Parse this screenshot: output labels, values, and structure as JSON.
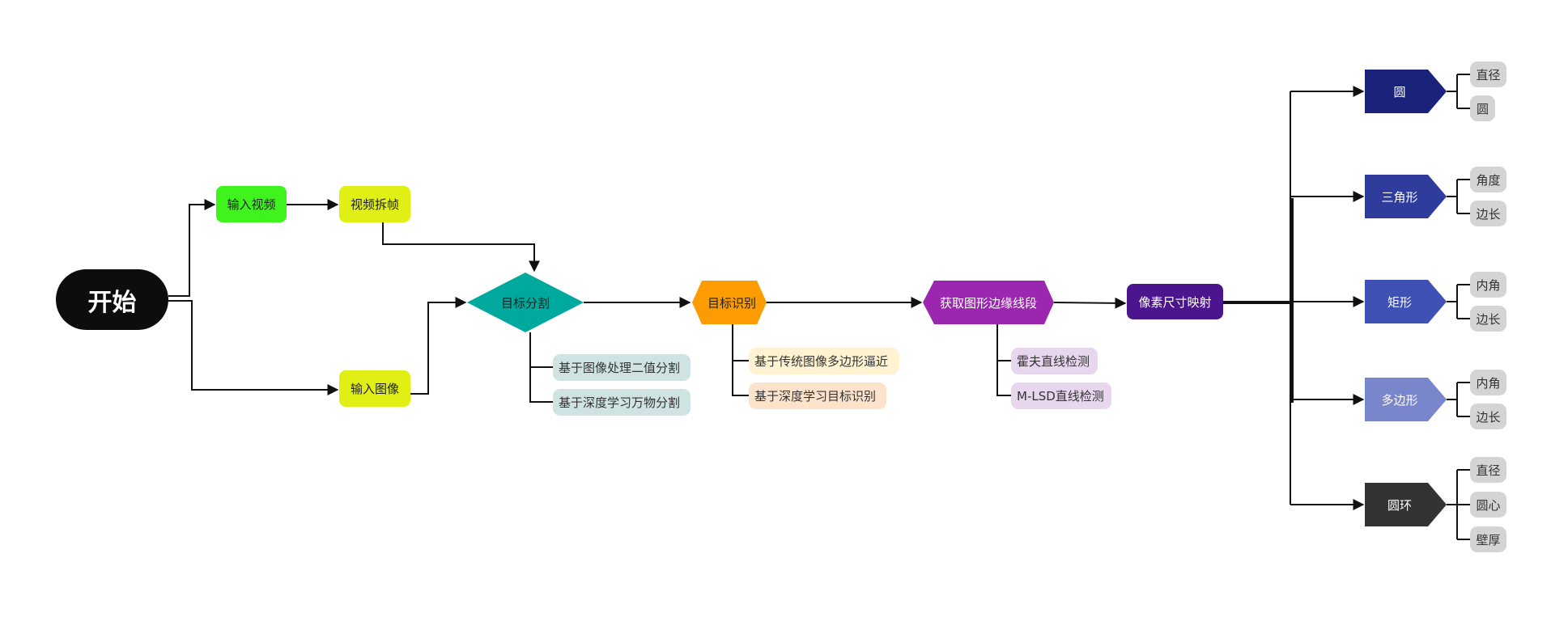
{
  "colors": {
    "start": "#0d0d0d",
    "input_video": "#3ef41c",
    "yellow": "#e0f015",
    "diamond": "#00a99d",
    "orange": "#fd9c00",
    "purple": "#9b27b0",
    "mapping": "#4b168d",
    "seg_sub": "#cfe4e2",
    "rec_sub1": "#fff3d1",
    "rec_sub2": "#fde3cc",
    "edge_sub": "#e8d5ee",
    "circle": "#1b227a",
    "triangle": "#2f3c9c",
    "rectangle": "#3f51b5",
    "polygon": "#7986cb",
    "ring": "#333333",
    "attr": "#d4d4d4",
    "line": "#111111"
  },
  "nodes": {
    "start": "开始",
    "input_video": "输入视频",
    "video_split": "视频拆帧",
    "input_image": "输入图像",
    "segmentation": "目标分割",
    "recognition": "目标识别",
    "edge_extract": "获取图形边缘线段",
    "pixel_mapping": "像素尺寸映射"
  },
  "segmentation_methods": [
    "基于图像处理二值分割",
    "基于深度学习万物分割"
  ],
  "recognition_methods": [
    "基于传统图像多边形逼近",
    "基于深度学习目标识别"
  ],
  "edge_methods": [
    "霍夫直线检测",
    "M-LSD直线检测"
  ],
  "shapes": [
    {
      "name": "圆",
      "attrs": [
        "直径",
        "圆"
      ]
    },
    {
      "name": "三角形",
      "attrs": [
        "角度",
        "边长"
      ]
    },
    {
      "name": "矩形",
      "attrs": [
        "内角",
        "边长"
      ]
    },
    {
      "name": "多边形",
      "attrs": [
        "内角",
        "边长"
      ]
    },
    {
      "name": "圆环",
      "attrs": [
        "直径",
        "圆心",
        "壁厚"
      ]
    }
  ]
}
